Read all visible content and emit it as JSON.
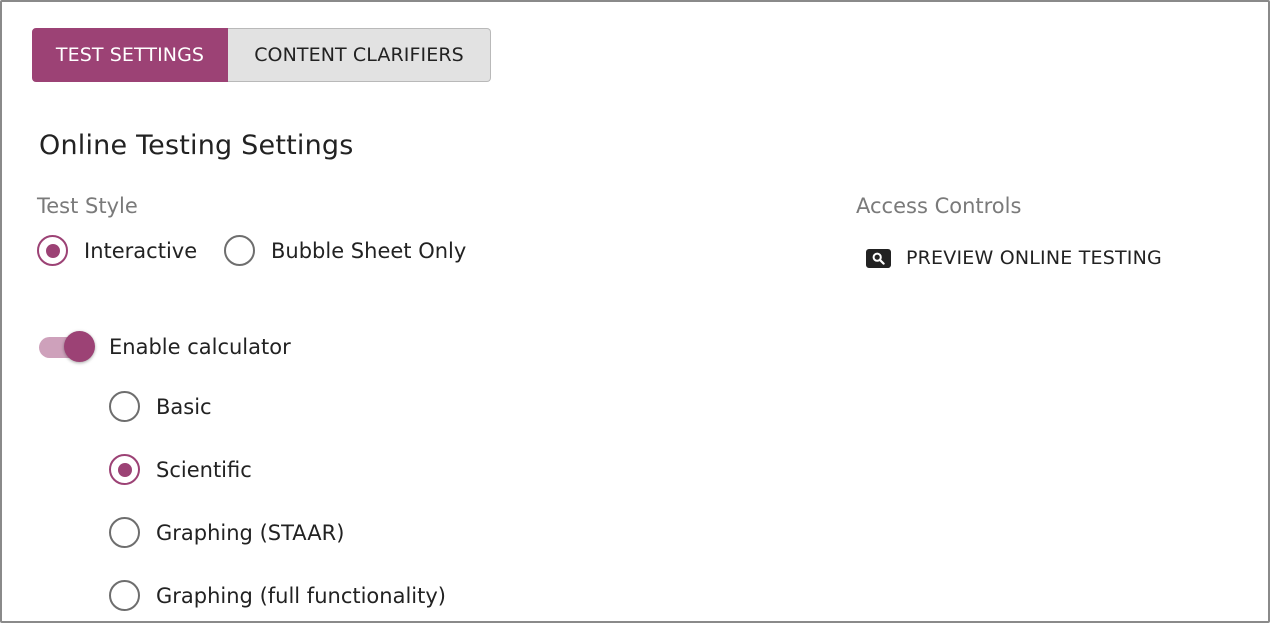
{
  "tabs": {
    "test_settings": "TEST SETTINGS",
    "content_clarifiers": "CONTENT CLARIFIERS"
  },
  "page_title": "Online Testing Settings",
  "test_style": {
    "label": "Test Style",
    "options": [
      {
        "label": "Interactive",
        "checked": true
      },
      {
        "label": "Bubble Sheet Only",
        "checked": false
      }
    ]
  },
  "calculator": {
    "toggle_label": "Enable calculator",
    "enabled": true,
    "options": [
      {
        "label": "Basic",
        "checked": false
      },
      {
        "label": "Scientific",
        "checked": true
      },
      {
        "label": "Graphing (STAAR)",
        "checked": false
      },
      {
        "label": "Graphing (full functionality)",
        "checked": false
      }
    ]
  },
  "access_controls": {
    "label": "Access Controls",
    "preview_label": "PREVIEW ONLINE TESTING",
    "preview_icon": "search-icon"
  },
  "colors": {
    "accent": "#9c4275",
    "accent_light": "#cea1bb",
    "tab_inactive_bg": "#e2e2e2",
    "muted_text": "#7a7a7a"
  }
}
